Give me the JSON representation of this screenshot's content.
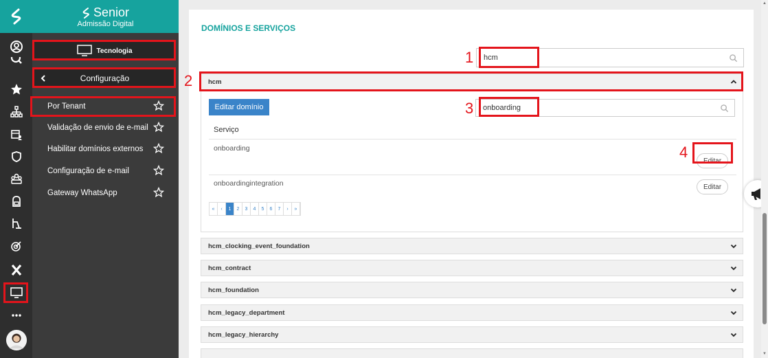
{
  "brand": {
    "name": "Senior",
    "subtitle": "Admissão Digital"
  },
  "menu": {
    "section_title": "Tecnologia",
    "submenu_title": "Configuração",
    "items": [
      {
        "label": "Por Tenant"
      },
      {
        "label": "Validação de envio de e-mail"
      },
      {
        "label": "Habilitar domínios externos"
      },
      {
        "label": "Configuração de e-mail"
      },
      {
        "label": "Gateway WhatsApp"
      }
    ]
  },
  "rail_icons": [
    "user-circle-icon",
    "search-icon",
    "star-icon",
    "org-chart-icon",
    "calendar-people-icon",
    "shield-icon",
    "group-icon",
    "backpack-icon",
    "person-board-icon",
    "target-icon",
    "x-icon",
    "monitor-icon",
    "more-icon",
    "avatar"
  ],
  "main": {
    "title": "DOMÍNIOS E SERVIÇOS",
    "domain_search_value": "hcm",
    "expanded_domain": {
      "name": "hcm",
      "edit_button": "Editar domínio",
      "service_search_value": "onboarding",
      "column_header": "Serviço",
      "services": [
        {
          "name": "onboarding",
          "action": "Editar"
        },
        {
          "name": "onboardingintegration",
          "action": "Editar"
        }
      ],
      "pagination": [
        "«",
        "‹",
        "1",
        "2",
        "3",
        "4",
        "5",
        "6",
        "7",
        "›",
        "»"
      ],
      "current_page": "1"
    },
    "other_domains": [
      "hcm_clocking_event_foundation",
      "hcm_contract",
      "hcm_foundation",
      "hcm_legacy_department",
      "hcm_legacy_hierarchy"
    ]
  },
  "annotations": [
    "1",
    "2",
    "3",
    "4"
  ],
  "colors": {
    "teal": "#16a39e",
    "red": "#e4141b",
    "blue": "#3a84c9",
    "sidebar": "#3b3b3b",
    "rail": "#2e2e2e"
  }
}
